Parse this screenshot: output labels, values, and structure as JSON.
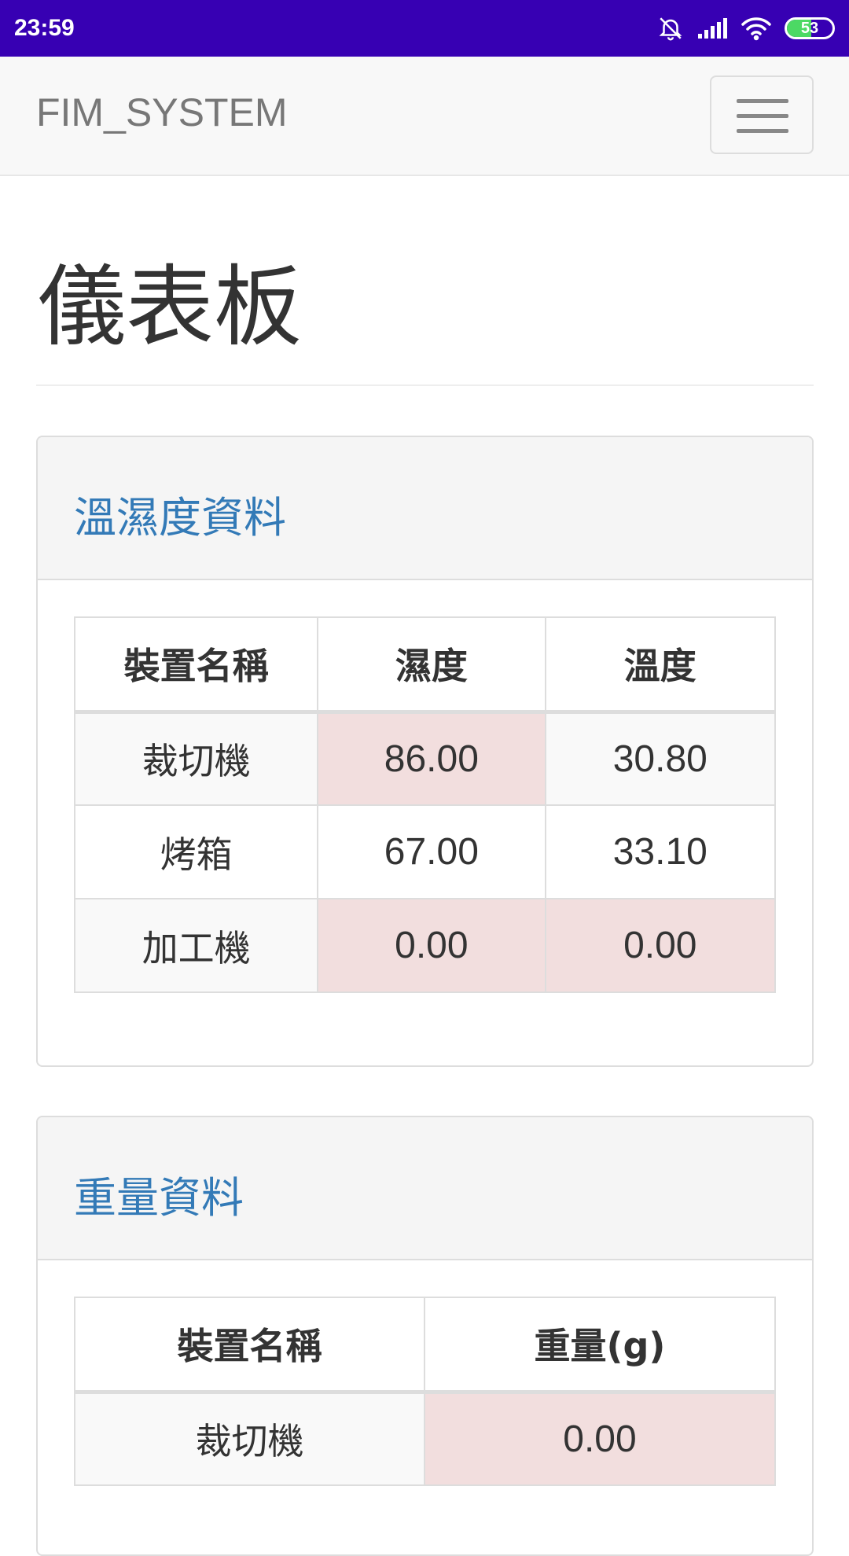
{
  "status_bar": {
    "time": "23:59",
    "battery_level": "53",
    "battery_fraction": 0.53,
    "icons": [
      "bell-muted-icon",
      "signal-icon",
      "wifi-icon",
      "battery-icon"
    ]
  },
  "navbar": {
    "brand": "FIM_SYSTEM",
    "toggle_icon": "hamburger-menu-icon"
  },
  "page": {
    "title": "儀表板"
  },
  "colors": {
    "status_bar": "#3700b3",
    "panel_title": "#337ab7",
    "alert_cell": "#f2dede",
    "battery": "#4cd964"
  },
  "panels": {
    "temp_humidity": {
      "title": "溫濕度資料",
      "headers": [
        "裝置名稱",
        "濕度",
        "溫度"
      ],
      "rows": [
        {
          "device": "裁切機",
          "humidity": "86.00",
          "temperature": "30.80"
        },
        {
          "device": "烤箱",
          "humidity": "67.00",
          "temperature": "33.10"
        },
        {
          "device": "加工機",
          "humidity": "0.00",
          "temperature": "0.00"
        }
      ]
    },
    "weight": {
      "title": "重量資料",
      "headers": [
        "裝置名稱",
        "重量(g)"
      ],
      "rows": [
        {
          "device": "裁切機",
          "weight": "0.00"
        }
      ]
    }
  }
}
